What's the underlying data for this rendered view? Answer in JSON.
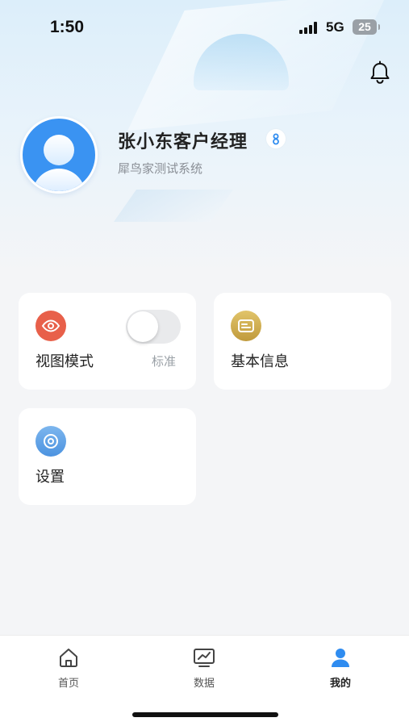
{
  "status_bar": {
    "time": "1:50",
    "network": "5G",
    "battery": "25"
  },
  "profile": {
    "name": "张小东客户经理",
    "company": "犀鸟家测试系统"
  },
  "cards": {
    "view_mode": {
      "title": "视图模式",
      "value": "标准",
      "toggle_on": false
    },
    "basic_info": {
      "title": "基本信息"
    },
    "settings": {
      "title": "设置"
    }
  },
  "tab_bar": {
    "home": "首页",
    "data": "数据",
    "mine": "我的",
    "active": "mine"
  },
  "colors": {
    "view_mode_icon": "#e8604a",
    "basic_info_icon": "#cfae4e",
    "settings_icon": "#6aa7e6",
    "accent_blue": "#3a93f2"
  },
  "icons": {
    "bell": "bell-icon",
    "view_mode": "eye-icon",
    "basic_info": "id-card-icon",
    "settings": "settings-icon",
    "home": "home-icon",
    "data": "chart-icon",
    "mine": "user-icon"
  }
}
